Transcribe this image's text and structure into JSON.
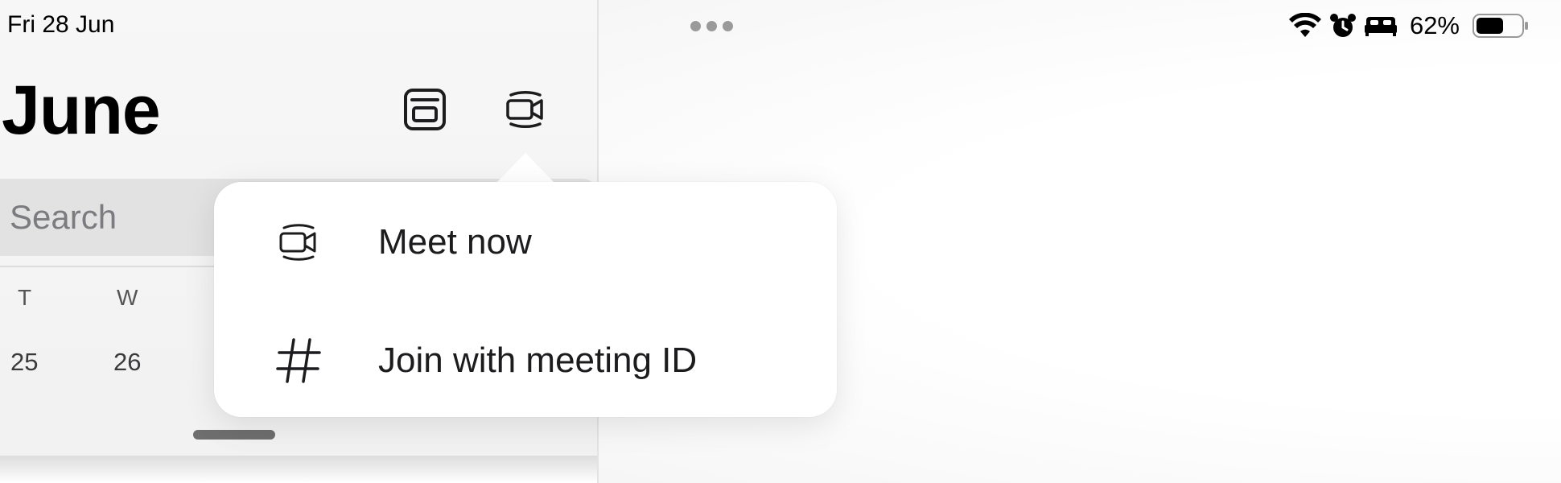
{
  "status_bar": {
    "date": "Fri 28 Jun",
    "battery_percent": "62%",
    "battery_level": 0.62,
    "icons": [
      "wifi-icon",
      "alarm-icon",
      "bed-icon",
      "battery-icon"
    ]
  },
  "header": {
    "title": "June",
    "buttons": [
      {
        "name": "today-view-button",
        "icon": "calendar-today-icon"
      },
      {
        "name": "meet-button",
        "icon": "video-camera-icon"
      }
    ]
  },
  "search": {
    "placeholder": "Search"
  },
  "calendar_strip": {
    "weekdays": [
      "T",
      "W"
    ],
    "dates": [
      "25",
      "26"
    ]
  },
  "popover_menu": {
    "items": [
      {
        "label": "Meet now",
        "icon": "video-camera-icon"
      },
      {
        "label": "Join with meeting ID",
        "icon": "hashtag-icon"
      }
    ]
  },
  "colors": {
    "text_primary": "#1c1c1e",
    "search_bg": "#e2e2e2",
    "placeholder": "#7c7c80",
    "popover_bg": "#ffffff"
  }
}
